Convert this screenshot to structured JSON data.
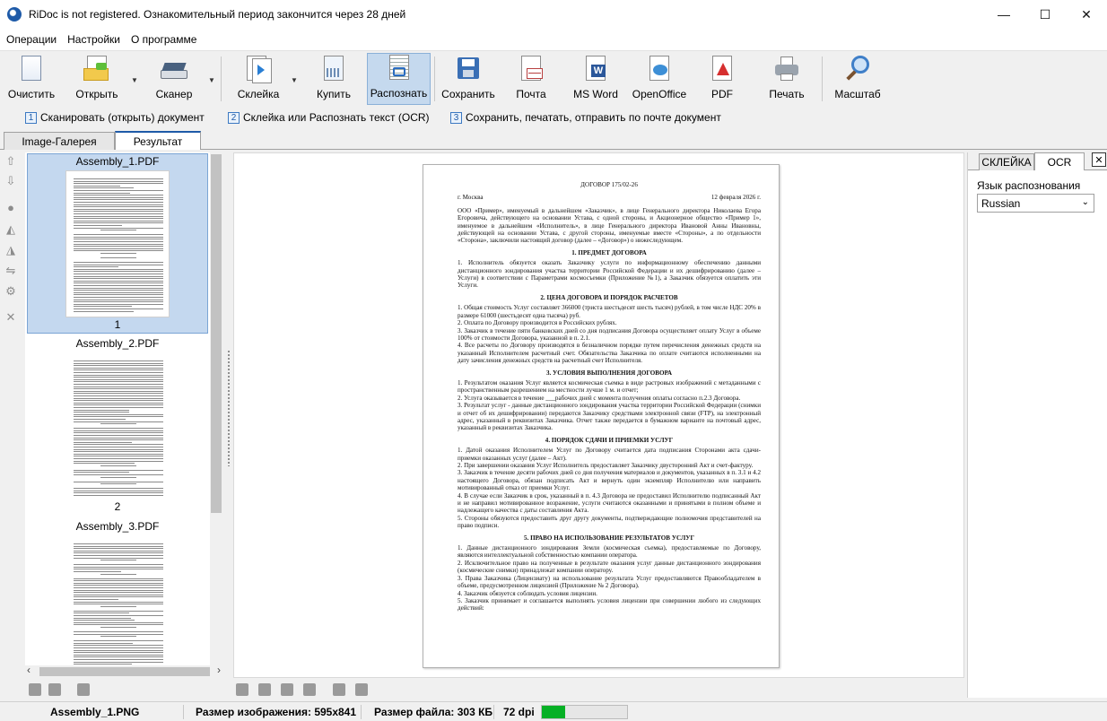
{
  "window": {
    "title": "RiDoc is not registered. Ознакомительный период закончится через 28 дней",
    "minimize_glyph": "—",
    "maximize_glyph": "☐",
    "close_glyph": "✕"
  },
  "menu": [
    "Операции",
    "Настройки",
    "О программе"
  ],
  "toolbar": {
    "clear": "Очистить",
    "open": "Открыть",
    "scanner": "Сканер",
    "glue": "Склейка",
    "buy": "Купить",
    "recognize": "Распознать",
    "save": "Сохранить",
    "mail": "Почта",
    "msword": "MS Word",
    "openoffice": "OpenOffice",
    "pdf": "PDF",
    "print": "Печать",
    "zoom": "Масштаб",
    "dropdown_glyph": "▼"
  },
  "steps": [
    {
      "num": "1",
      "label": "Сканировать (открыть) документ"
    },
    {
      "num": "2",
      "label": "Склейка или Распознать текст (OCR)"
    },
    {
      "num": "3",
      "label": "Сохранить, печатать, отправить по почте документ"
    }
  ],
  "tabs": {
    "gallery": "Image-Галерея",
    "result": "Результат"
  },
  "gallery": {
    "items": [
      {
        "title": "Assembly_1.PDF",
        "num": "1"
      },
      {
        "title": "Assembly_2.PDF",
        "num": "2"
      },
      {
        "title": "Assembly_3.PDF",
        "num": ""
      }
    ]
  },
  "left_tools": {
    "up": "⇧",
    "down": "⇩",
    "circle": "●",
    "rotate_left": "◭",
    "rotate_right": "◮",
    "flip": "⇋",
    "settings": "⚙",
    "delete": "✕"
  },
  "document": {
    "title": "ДОГОВОР  175/02-26",
    "city": "г. Москва",
    "date": "12 февраля 2026 г.",
    "intro": "ООО «Пример», именуемый в дальнейшем «Заказчик», в лице Генерального директора Николаева Егора Егоровича, действующего на основании Устава, с одной стороны, и Акционерное общество «Пример 1», именуемое в дальнейшем «Исполнитель», в лице Генерального директора Ивановой Анны Ивановны, действующей на основании Устава, с другой стороны, именуемые вместе «Стороны», а по отдельности «Сторона», заключили настоящий договор (далее – «Договор») о нижеследующем.",
    "sections": [
      {
        "head": "1.  ПРЕДМЕТ ДОГОВОРА",
        "paras": [
          "1.      Исполнитель обязуется оказать Заказчику услуги по информационному обеспечению данными дистанционного зондирования участка территории Российской Федерации и их дешифрированию (далее – Услуги) в соответствии с Параметрами космосъемки (Приложение №1), а Заказчик обязуется оплатить эти Услуги."
        ]
      },
      {
        "head": "2. ЦЕНА ДОГОВОРА И ПОРЯДОК РАСЧЕТОВ",
        "paras": [
          "1.    Общая стоимость Услуг составляет 366000 (триста шестьдесят шесть тысяч) рублей, в том числе НДС 20% в размере 61000 (шестьдесят одна тысяча) руб.",
          "2.    Оплата по Договору производится в Российских рублях.",
          "3.    Заказчик в течение пяти банковских дней со дня подписания Договора осуществляет оплату Услуг в объеме 100% от стоимости Договора, указанной в п. 2.1.",
          "4.    Все расчеты по Договору производятся в безналичном порядке путем перечисления денежных средств на указанный Исполнителем расчетный счет. Обязательства Заказчика по оплате считаются исполненными на дату зачисления денежных средств на расчетный счет Исполнителя."
        ]
      },
      {
        "head": "3. УСЛОВИЯ ВЫПОЛНЕНИЯ ДОГОВОРА",
        "paras": [
          "1.    Результатом оказания Услуг является космическая съемка в виде растровых изображений с метаданными с пространственным разрешением на местности лучше 1 м. и отчет;",
          "2.    Услуга оказывается в течение ___рабочих дней с момента получения оплаты согласно п.2.3 Договора.",
          "3.    Результат услуг - данные дистанционного зондирования участка территории Российской Федерации (снимки и отчет об их дешифрировании) передаются Заказчику средствами электронной связи (FTP), на электронный адрес, указанный в реквизитах Заказчика. Отчет также передается в бумажном варианте на почтовый адрес, указанный в реквизитах Заказчика."
        ]
      },
      {
        "head": "4. ПОРЯДОК СДАЧИ И ПРИЕМКИ УСЛУГ",
        "paras": [
          "1.    Датой оказания Исполнителем Услуг по Договору считается дата подписания Сторонами акта сдачи-приемки оказанных услуг (далее – Акт).",
          "2.    При завершении оказания Услуг Исполнитель предоставляет Заказчику двусторонний Акт и счет-фактуру.",
          "3.    Заказчик в течение десяти рабочих дней со дня получения материалов и документов, указанных в п. 3.1 и 4.2 настоящего Договора, обязан подписать Акт и вернуть один экземпляр Исполнителю или направить мотивированный отказ от приемки Услуг.",
          "4.    В случае если Заказчик в срок, указанный в п. 4.3 Договора не предоставил Исполнителю подписанный Акт и не направил мотивированное возражение, услуги считаются оказанными и принятыми в полном объеме и надлежащего качества с даты составления Акта.",
          "5.    Стороны обязуются предоставить друг другу документы, подтверждающие полномочия представителей на право подписи."
        ]
      },
      {
        "head": "5. ПРАВО НА ИСПОЛЬЗОВАНИЕ РЕЗУЛЬТАТОВ УСЛУГ",
        "paras": [
          "1.        Данные дистанционного зондирования Земли (космическая съемка), предоставляемые по Договору, являются интеллектуальной собственностью компании оператора.",
          "2.        Исключительное право на полученные в результате оказания услуг данные дистанционного зондирования (космические снимки) принадлежат компании оператору.",
          "3.        Права Заказчика (Лицензиату) на использование результата Услуг предоставляются Правообладателем в объеме, предусмотренном лицензией (Приложение № 2 Договора).",
          "4.        Заказчик обязуется соблюдать условия лицензии.",
          "5.        Заказчик принимает и соглашается выполнять условия лицензии при совершении любого из следующих действий:"
        ]
      }
    ]
  },
  "right_panel": {
    "tab_glue": "СКЛЕЙКА",
    "tab_ocr": "OCR",
    "close_glyph": "✕",
    "lang_label": "Язык распознования",
    "lang_value": "Russian",
    "chevron": "⌄"
  },
  "scroll": {
    "up": "˄",
    "down": "˅",
    "left": "‹",
    "right": "›"
  },
  "status": {
    "file": "Assembly_1.PNG",
    "image_size": "Размер изображения: 595x841",
    "file_size": "Размер файла: 303 КБ",
    "dpi": "72 dpi",
    "progress_fraction": 0.27
  },
  "colors": {
    "accent": "#1e5aa8",
    "selected": "#c4d8ef",
    "progress": "#06b025"
  }
}
